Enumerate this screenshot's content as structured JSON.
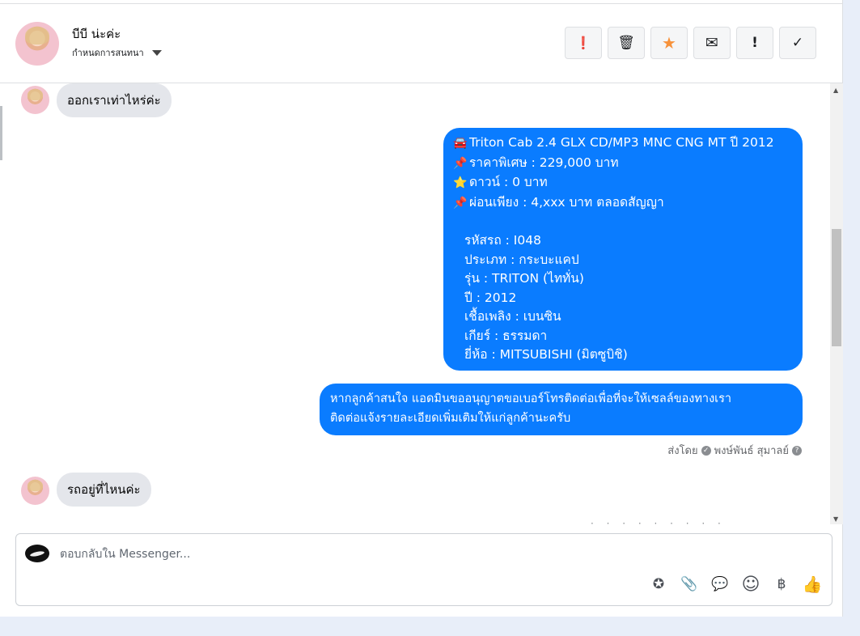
{
  "header": {
    "contact_name": "บีบี น่ะค่ะ",
    "chat_settings_label": "กำหนดการสนทนา",
    "toolbar": [
      {
        "name": "spam-button",
        "icon": "exclamation-circle-icon",
        "glyph": "❗"
      },
      {
        "name": "delete-button",
        "icon": "trash-icon",
        "glyph": "🗑"
      },
      {
        "name": "star-button",
        "icon": "star-icon",
        "glyph": "★"
      },
      {
        "name": "mark-unread-button",
        "icon": "envelope-icon",
        "glyph": "✉"
      },
      {
        "name": "follow-up-button",
        "icon": "exclamation-icon",
        "glyph": "!"
      },
      {
        "name": "mark-done-button",
        "icon": "check-icon",
        "glyph": "✓"
      }
    ]
  },
  "messages": {
    "m1": "ออกเราเท่าไหร่ค่ะ",
    "car": {
      "l1_emoji": "🚘",
      "l1": "Triton Cab 2.4 GLX CD/MP3 MNC  CNG MT ปี 2012",
      "l2_emoji": "📌",
      "l2": "ราคาพิเศษ : 229,000 บาท",
      "l3_emoji": "⭐",
      "l3": "ดาวน์ : 0 บาท",
      "l4_emoji": "📌",
      "l4": "ผ่อนเพียง : 4,xxx บาท ตลอดสัญญา",
      "d1": "รหัสรถ : I048",
      "d2": "ประเภท : กระบะแคป",
      "d3": "รุ่น : TRITON (ไททั่น)",
      "d4": "ปี : 2012",
      "d5": "เชื้อเพลิง : เบนซิน",
      "d6": "เกียร์ : ธรรมดา",
      "d7": "ยี่ห้อ : MITSUBISHI (มิตซูบิชิ)"
    },
    "admin_line1": "หากลูกค้าสนใจ แอดมินขออนุญาตขอเบอร์โทรติดต่อเพื่อที่จะให้เซลล์ของทางเรา",
    "admin_line2": "ติดต่อแจ้งรายละเอียดเพิ่มเติมให้แก่ลูกค้านะครับ",
    "sent_by_prefix": "ส่งโดย",
    "sent_by_name": "พงษ์พันธ์ สุมาลย์",
    "m2": "รถอยู่ที่ไหนค่ะ"
  },
  "composer": {
    "placeholder": "ตอบกลับใน Messenger...",
    "tools": [
      {
        "name": "saved-reply-icon",
        "glyph": "✪"
      },
      {
        "name": "attachment-icon",
        "glyph": "📎"
      },
      {
        "name": "quick-reply-icon",
        "glyph": "💬"
      },
      {
        "name": "emoji-icon",
        "glyph": "☺"
      },
      {
        "name": "baht-payment-icon",
        "glyph": "฿"
      },
      {
        "name": "thumbs-up-icon",
        "glyph": "👍"
      }
    ]
  },
  "colors": {
    "outgoing_bubble": "#0a7cff",
    "incoming_bubble": "#e4e6eb",
    "star": "#f7923b"
  }
}
